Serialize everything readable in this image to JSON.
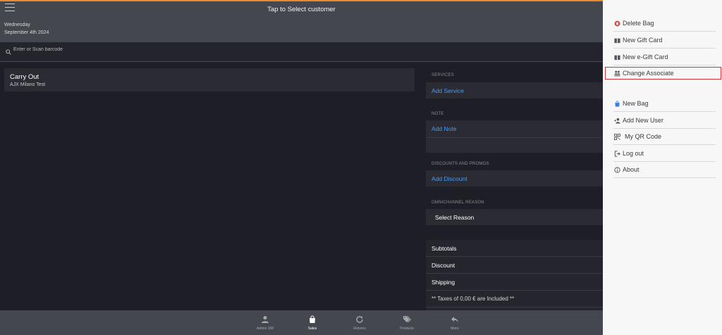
{
  "header": {
    "title": "Tap to Select customer",
    "day": "Wednesday",
    "date": "September 4th 2024"
  },
  "search": {
    "placeholder": "Enter or Scan barcode"
  },
  "bag": {
    "title": "Carry Out",
    "subtitle": "AJX Milano Test"
  },
  "panel": {
    "services_label": "SERVICES",
    "add_service": "Add Service",
    "note_label": "NOTE",
    "add_note": "Add Note",
    "discounts_label": "DISCOUNTS AND PROMOS",
    "add_discount": "Add Discount",
    "omni_label": "OMNICHANNEL REASON",
    "select_reason": "Select Reason"
  },
  "totals": {
    "subtotals": "Subtotals",
    "discount": "Discount",
    "shipping": "Shipping",
    "taxes": "** Taxes of 0,00 € are Included **"
  },
  "bottom_nav": [
    {
      "label": "Admin 168",
      "icon": "user-icon"
    },
    {
      "label": "Sales",
      "icon": "bag-icon"
    },
    {
      "label": "Returns",
      "icon": "refresh-icon"
    },
    {
      "label": "Products",
      "icon": "tags-icon"
    },
    {
      "label": "More",
      "icon": "reply-icon"
    }
  ],
  "menu": {
    "items": [
      {
        "label": "Delete Bag",
        "icon": "delete-bag-icon"
      },
      {
        "label": "New Gift Card",
        "icon": "gift-card-icon"
      },
      {
        "label": "New e-Gift Card",
        "icon": "e-gift-card-icon"
      },
      {
        "label": "Change Associate",
        "icon": "change-associate-icon"
      },
      {
        "label": "New Bag",
        "icon": "new-bag-icon"
      },
      {
        "label": "Add New User",
        "icon": "add-user-icon"
      },
      {
        "label": "My QR Code",
        "icon": "qr-code-icon"
      },
      {
        "label": "Log out",
        "icon": "logout-icon"
      },
      {
        "label": "About",
        "icon": "info-icon"
      }
    ]
  },
  "colors": {
    "accent": "#e8892a",
    "link": "#4c9bf0",
    "highlight": "#d4323a",
    "delete": "#d8453b",
    "new_bag": "#3b7dd8"
  }
}
